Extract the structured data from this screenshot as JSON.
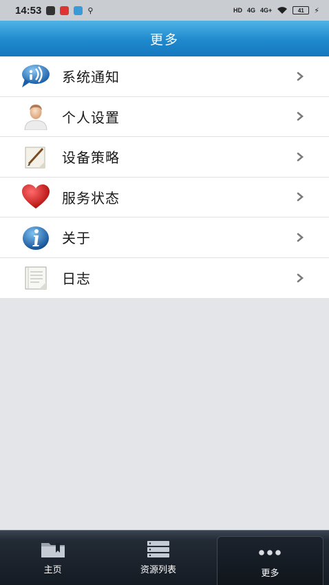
{
  "status_bar": {
    "time": "14:53",
    "network_labels": [
      "4G",
      "4G+"
    ],
    "battery_level": "41"
  },
  "header": {
    "title": "更多"
  },
  "menu": {
    "items": [
      {
        "label": "系统通知",
        "icon": "notification-bubble-icon"
      },
      {
        "label": "个人设置",
        "icon": "person-icon"
      },
      {
        "label": "设备策略",
        "icon": "pen-paper-icon"
      },
      {
        "label": "服务状态",
        "icon": "heart-icon"
      },
      {
        "label": "关于",
        "icon": "info-icon"
      },
      {
        "label": "日志",
        "icon": "log-document-icon"
      }
    ]
  },
  "tab_bar": {
    "tabs": [
      {
        "label": "主页",
        "icon": "folder-bookmark-icon",
        "active": false
      },
      {
        "label": "资源列表",
        "icon": "server-list-icon",
        "active": false
      },
      {
        "label": "更多",
        "icon": "more-dots-icon",
        "active": true
      }
    ]
  },
  "colors": {
    "header_blue": "#1f89cd",
    "tab_bar_dark": "#151b23",
    "heart_red": "#d21a1a",
    "info_blue": "#1d6fc2"
  }
}
